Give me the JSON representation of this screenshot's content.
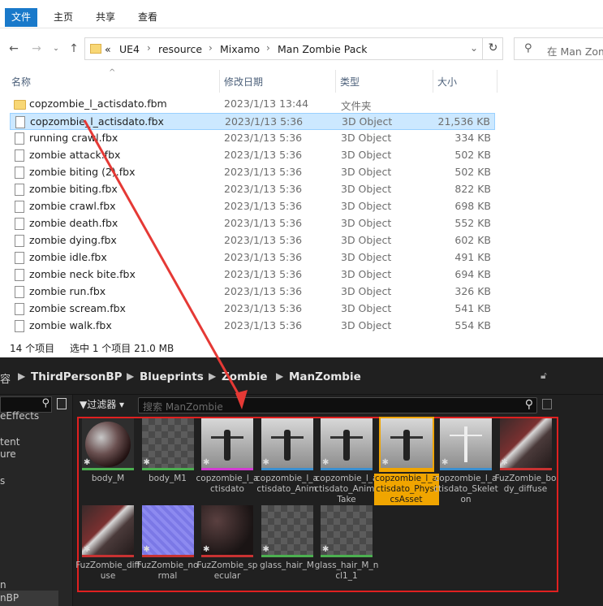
{
  "explorer": {
    "title": "Man Zombie Pack",
    "ribbon_tabs": [
      {
        "label": "文件",
        "active": true
      },
      {
        "label": "主页",
        "active": false
      },
      {
        "label": "共享",
        "active": false
      },
      {
        "label": "查看",
        "active": false
      }
    ],
    "path": [
      "«",
      "UE4",
      "resource",
      "Mixamo",
      "Man Zombie Pack"
    ],
    "search_placeholder": "在 Man Zom",
    "columns": {
      "name": "名称",
      "date": "修改日期",
      "type": "类型",
      "size": "大小"
    },
    "files": [
      {
        "name": "copzombie_l_actisdato.fbm",
        "date": "2023/1/13 13:44",
        "type": "文件夹",
        "size": "",
        "folder": true,
        "selected": false
      },
      {
        "name": "copzombie_l_actisdato.fbx",
        "date": "2023/1/13 5:36",
        "type": "3D Object",
        "size": "21,536 KB",
        "folder": false,
        "selected": true
      },
      {
        "name": "running crawl.fbx",
        "date": "2023/1/13 5:36",
        "type": "3D Object",
        "size": "334 KB",
        "folder": false,
        "selected": false
      },
      {
        "name": "zombie attack.fbx",
        "date": "2023/1/13 5:36",
        "type": "3D Object",
        "size": "502 KB",
        "folder": false,
        "selected": false
      },
      {
        "name": "zombie biting (2).fbx",
        "date": "2023/1/13 5:36",
        "type": "3D Object",
        "size": "502 KB",
        "folder": false,
        "selected": false
      },
      {
        "name": "zombie biting.fbx",
        "date": "2023/1/13 5:36",
        "type": "3D Object",
        "size": "822 KB",
        "folder": false,
        "selected": false
      },
      {
        "name": "zombie crawl.fbx",
        "date": "2023/1/13 5:36",
        "type": "3D Object",
        "size": "698 KB",
        "folder": false,
        "selected": false
      },
      {
        "name": "zombie death.fbx",
        "date": "2023/1/13 5:36",
        "type": "3D Object",
        "size": "552 KB",
        "folder": false,
        "selected": false
      },
      {
        "name": "zombie dying.fbx",
        "date": "2023/1/13 5:36",
        "type": "3D Object",
        "size": "602 KB",
        "folder": false,
        "selected": false
      },
      {
        "name": "zombie idle.fbx",
        "date": "2023/1/13 5:36",
        "type": "3D Object",
        "size": "491 KB",
        "folder": false,
        "selected": false
      },
      {
        "name": "zombie neck bite.fbx",
        "date": "2023/1/13 5:36",
        "type": "3D Object",
        "size": "694 KB",
        "folder": false,
        "selected": false
      },
      {
        "name": "zombie run.fbx",
        "date": "2023/1/13 5:36",
        "type": "3D Object",
        "size": "326 KB",
        "folder": false,
        "selected": false
      },
      {
        "name": "zombie scream.fbx",
        "date": "2023/1/13 5:36",
        "type": "3D Object",
        "size": "541 KB",
        "folder": false,
        "selected": false
      },
      {
        "name": "zombie walk.fbx",
        "date": "2023/1/13 5:36",
        "type": "3D Object",
        "size": "554 KB",
        "folder": false,
        "selected": false
      }
    ],
    "status": {
      "count": "14 个项目",
      "selection": "选中 1 个项目  21.0 MB"
    }
  },
  "ue": {
    "breadcrumb": [
      "ThirdPersonBP",
      "Blueprints",
      "Zombie",
      "ManZombie"
    ],
    "left_items": [
      "eEffects",
      "tent",
      "ure",
      "s",
      "n",
      "nBP"
    ],
    "filter_label": "▼过滤器 ▾",
    "search_placeholder": "搜索 ManZombie",
    "assets": [
      {
        "label": "body_M",
        "style": "sphere",
        "color": "#4caf50",
        "selected": false
      },
      {
        "label": "body_M1",
        "style": "checker",
        "color": "#4caf50",
        "selected": false
      },
      {
        "label": "copzombie_l_actisdato",
        "style": "figure",
        "color": "#d23ad2",
        "selected": false
      },
      {
        "label": "copzombie_l_actisdato_Anim",
        "style": "figure",
        "color": "#3a8fd0",
        "selected": false
      },
      {
        "label": "copzombie_l_actisdato_Anim_Take",
        "style": "figure",
        "color": "#3a8fd0",
        "selected": false
      },
      {
        "label": "copzombie_l_actisdato_PhysicsAsset",
        "style": "figure",
        "color": "#f0a500",
        "selected": true
      },
      {
        "label": "copzombie_l_actisdato_Skeleton",
        "style": "skeleton",
        "color": "#3a8fd0",
        "selected": false
      },
      {
        "label": "FuzZombie_body_diffuse",
        "style": "diffuse",
        "color": "#c83232",
        "selected": false
      },
      {
        "label": "FuzZombie_diffuse",
        "style": "diffuse",
        "color": "#c83232",
        "selected": false
      },
      {
        "label": "FuzZombie_normal",
        "style": "normal",
        "color": "#c83232",
        "selected": false
      },
      {
        "label": "FuzZombie_specular",
        "style": "dark",
        "color": "#c83232",
        "selected": false
      },
      {
        "label": "glass_hair_M",
        "style": "checker",
        "color": "#4caf50",
        "selected": false
      },
      {
        "label": "glass_hair_M_ncl1_1",
        "style": "checker",
        "color": "#4caf50",
        "selected": false
      }
    ]
  }
}
